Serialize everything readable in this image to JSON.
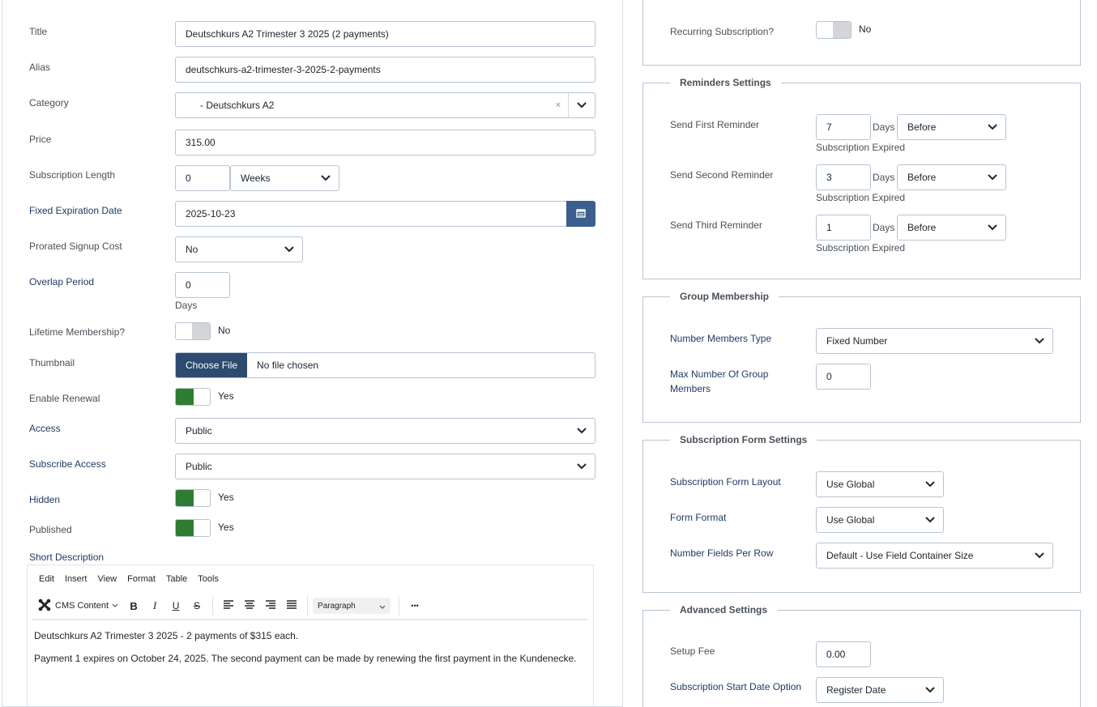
{
  "left": {
    "title": {
      "label": "Title",
      "value": "Deutschkurs A2 Trimester 3 2025 (2 payments)"
    },
    "alias": {
      "label": "Alias",
      "value": "deutschkurs-a2-trimester-3-2025-2-payments"
    },
    "category": {
      "label": "Category",
      "value": "- Deutschkurs A2",
      "clear": "×"
    },
    "price": {
      "label": "Price",
      "value": "315.00"
    },
    "subscription_length": {
      "label": "Subscription Length",
      "value": "0",
      "unit": "Weeks"
    },
    "fixed_expiration": {
      "label": "Fixed Expiration Date",
      "value": "2025-10-23"
    },
    "prorated": {
      "label": "Prorated Signup Cost",
      "value": "No"
    },
    "overlap": {
      "label": "Overlap Period",
      "value": "0",
      "unit": "Days"
    },
    "lifetime": {
      "label": "Lifetime Membership?",
      "state": "No"
    },
    "thumbnail": {
      "label": "Thumbnail",
      "button": "Choose File",
      "status": "No file chosen"
    },
    "renewal": {
      "label": "Enable Renewal",
      "state": "Yes"
    },
    "access": {
      "label": "Access",
      "value": "Public"
    },
    "subscribe_access": {
      "label": "Subscribe Access",
      "value": "Public"
    },
    "hidden": {
      "label": "Hidden",
      "state": "Yes"
    },
    "published": {
      "label": "Published",
      "state": "Yes"
    },
    "short_description": {
      "label": "Short Description"
    }
  },
  "editor": {
    "menu": [
      "Edit",
      "Insert",
      "View",
      "Format",
      "Table",
      "Tools"
    ],
    "cms_content": "CMS Content",
    "format_select": "Paragraph",
    "more": "•••",
    "bold": "B",
    "italic": "I",
    "underline": "U",
    "strike": "S",
    "paragraphs": [
      "Deutschkurs A2 Trimester 3 2025 - 2 payments of $315 each.",
      "Payment 1 expires on October 24, 2025. The second payment can be made by renewing the first payment in the Kundenecke."
    ]
  },
  "right": {
    "recurring": {
      "label": "Recurring Subscription?",
      "state": "No"
    },
    "reminders": {
      "legend": "Reminders Settings",
      "items": [
        {
          "label": "Send First Reminder",
          "days": "7",
          "unit": "Days",
          "when": "Before",
          "help": "Subscription Expired"
        },
        {
          "label": "Send Second Reminder",
          "days": "3",
          "unit": "Days",
          "when": "Before",
          "help": "Subscription Expired"
        },
        {
          "label": "Send Third Reminder",
          "days": "1",
          "unit": "Days",
          "when": "Before",
          "help": "Subscription Expired"
        }
      ]
    },
    "group": {
      "legend": "Group Membership",
      "type_label": "Number Members Type",
      "type_value": "Fixed Number",
      "max_label_1": "Max Number Of Group",
      "max_label_2": "Members",
      "max_value": "0"
    },
    "form_settings": {
      "legend": "Subscription Form Settings",
      "layout_label": "Subscription Form Layout",
      "layout_value": "Use Global",
      "format_label": "Form Format",
      "format_value": "Use Global",
      "fields_label": "Number Fields Per Row",
      "fields_value": "Default - Use Field Container Size"
    },
    "advanced": {
      "legend": "Advanced Settings",
      "setup_label": "Setup Fee",
      "setup_value": "0.00",
      "start_label": "Subscription Start Date Option",
      "start_value": "Register Date"
    }
  },
  "colors": {
    "accent": "#2e7d32",
    "primary": "#2d4a6f",
    "calendar": "#3a5f8c",
    "border": "#b8c4d2"
  }
}
